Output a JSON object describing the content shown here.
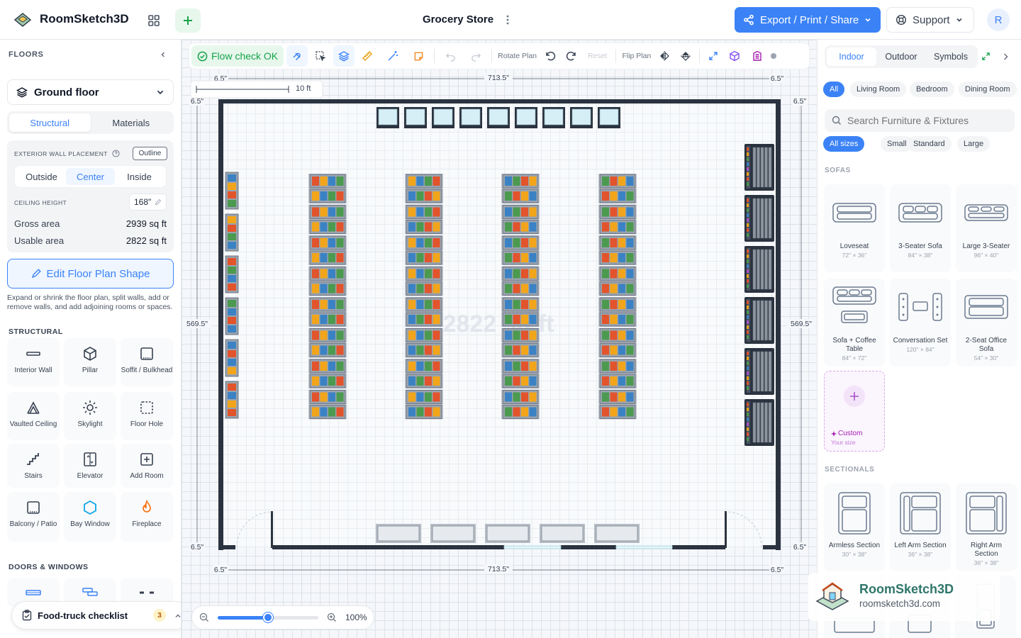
{
  "app": {
    "name": "RoomSketch3D",
    "project_title": "Grocery Store",
    "avatar_initial": "R"
  },
  "header": {
    "export_label": "Export / Print / Share",
    "support_label": "Support"
  },
  "left": {
    "floors_label": "FLOORS",
    "floor_selected": "Ground floor",
    "tabs": [
      "Structural",
      "Materials"
    ],
    "ext_wall_label": "EXTERIOR WALL PLACEMENT",
    "outline_label": "Outline",
    "wall_options": [
      "Outside",
      "Center",
      "Inside"
    ],
    "ceiling_label": "CEILING HEIGHT",
    "ceiling_value": "168\"",
    "gross_label": "Gross area",
    "gross_value": "2939 sq ft",
    "usable_label": "Usable area",
    "usable_value": "2822 sq ft",
    "edit_button": "Edit Floor Plan Shape",
    "help_text": "Expand or shrink the floor plan, split walls, add or remove walls, and add adjoining rooms or spaces.",
    "structural_label": "STRUCTURAL",
    "tools": [
      {
        "label": "Interior Wall",
        "icon": "wall-icon"
      },
      {
        "label": "Pillar",
        "icon": "cube-icon"
      },
      {
        "label": "Soffit / Bulkhead",
        "icon": "soffit-icon"
      },
      {
        "label": "Vaulted Ceiling",
        "icon": "vault-icon"
      },
      {
        "label": "Skylight",
        "icon": "sun-icon"
      },
      {
        "label": "Floor Hole",
        "icon": "dashed-square-icon"
      },
      {
        "label": "Stairs",
        "icon": "stairs-icon"
      },
      {
        "label": "Elevator",
        "icon": "elevator-icon"
      },
      {
        "label": "Add Room",
        "icon": "plus-square-icon"
      },
      {
        "label": "Balcony / Patio",
        "icon": "balcony-icon"
      },
      {
        "label": "Bay Window",
        "icon": "hexagon-icon"
      },
      {
        "label": "Fireplace",
        "icon": "flame-icon"
      }
    ],
    "doors_label": "DOORS & WINDOWS",
    "checklist_label": "Food-truck checklist",
    "checklist_count": "3"
  },
  "toolbar": {
    "flow_check": "Flow check OK",
    "rotate_label": "Rotate Plan",
    "reset_label": "Reset",
    "flip_label": "Flip Plan"
  },
  "canvas": {
    "scale_label": "10 ft",
    "dim_top": "713.5\"",
    "dim_bottom": "713.5\"",
    "dim_left": "569.5\"",
    "dim_right": "569.5\"",
    "corner_dim": "6.5\"",
    "area_watermark": "2822 sq ft",
    "zoom_value": "100%",
    "zoom_level": 0.5
  },
  "right": {
    "tabs": [
      "Indoor",
      "Outdoor",
      "Symbols"
    ],
    "room_chips": [
      "All",
      "Living Room",
      "Bedroom",
      "Dining Room"
    ],
    "search_placeholder": "Search Furniture & Fixtures",
    "size_chips": [
      "All sizes",
      "Small",
      "Standard",
      "Large"
    ],
    "sofas_label": "SOFAS",
    "sofas": [
      {
        "name": "Loveseat",
        "size": "72\" × 36\""
      },
      {
        "name": "3-Seater Sofa",
        "size": "84\" × 38\""
      },
      {
        "name": "Large 3-Seater",
        "size": "96\" × 40\""
      },
      {
        "name": "Sofa + Coffee Table",
        "size": "84\" × 72\""
      },
      {
        "name": "Conversation Set",
        "size": "120\" × 84\""
      },
      {
        "name": "2-Seat Office Sofa",
        "size": "54\" × 30\""
      }
    ],
    "custom": {
      "name": "Custom",
      "size": "Your size"
    },
    "sectionals_label": "SECTIONALS",
    "sectionals": [
      {
        "name": "Armless Section",
        "size": "30\" × 38\""
      },
      {
        "name": "Left Arm Section",
        "size": "36\" × 38\""
      },
      {
        "name": "Right Arm Section",
        "size": "36\" × 38\""
      }
    ]
  },
  "watermark": {
    "brand": "RoomSketch3D",
    "url": "roomsketch3d.com"
  },
  "colors": {
    "accent": "#3b82f6",
    "success": "#16a34a",
    "wall": "#2b3340"
  }
}
